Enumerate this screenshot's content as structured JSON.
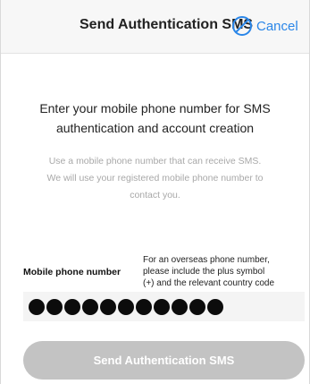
{
  "header": {
    "title": "Send Authentication SMS",
    "cancel_label": "Cancel",
    "cancel_icon": "cancel-circle-icon"
  },
  "intro": {
    "line1": "Enter your mobile phone number for SMS",
    "line2": "authentication and account creation"
  },
  "note": {
    "line1": "Use a mobile phone number that can receive SMS.",
    "line2": "We will use your registered mobile phone number to",
    "line3": "contact you."
  },
  "phone_field": {
    "label": "Mobile phone number",
    "help_line1": "For an overseas phone number,",
    "help_line2": "please include the plus symbol",
    "help_line3": "(+) and the relevant country code",
    "masked_digit_count": 11
  },
  "send_button": {
    "label": "Send Authentication SMS"
  },
  "colors": {
    "accent": "#2a86e8",
    "button_disabled": "#c3c3c3",
    "header_bg": "#f7f7f7",
    "note_text": "#a8a8a8"
  }
}
